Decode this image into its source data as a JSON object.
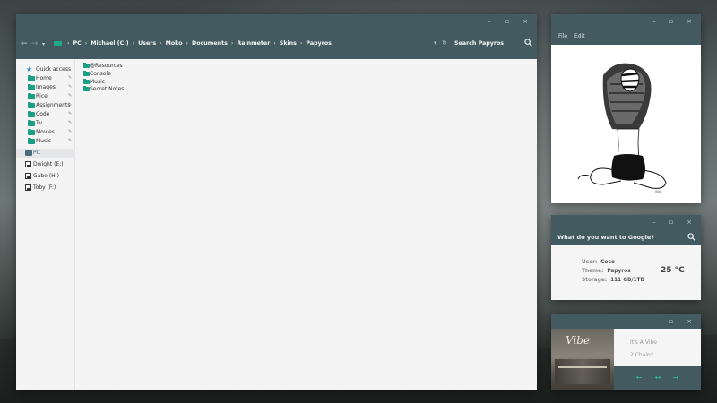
{
  "explorer": {
    "controls": {
      "minimize": "–",
      "maximize": "▫",
      "close": "×"
    },
    "nav": {
      "back": "←",
      "forward": "→",
      "up": "↑"
    },
    "breadcrumbs": [
      "PC",
      "Michael (C:)",
      "Users",
      "Moko",
      "Documents",
      "Rainmeter",
      "Skins",
      "Papyros"
    ],
    "search_placeholder": "Search Papyros",
    "sidebar": {
      "quick_access_label": "Quick access",
      "pinned": [
        {
          "label": "Home",
          "pin": "✎"
        },
        {
          "label": "Images",
          "pin": "✎"
        },
        {
          "label": "Rice",
          "pin": "✎"
        },
        {
          "label": "Assignments",
          "pin": "✎"
        },
        {
          "label": "Code",
          "pin": "✎"
        },
        {
          "label": "Tv",
          "pin": "✎"
        },
        {
          "label": "Movies",
          "pin": "✎"
        },
        {
          "label": "Music",
          "pin": "✎"
        }
      ],
      "pc_label": "PC",
      "drives": [
        "Dwight (E:)",
        "Gabe (H:)",
        "Toby (F:)"
      ]
    },
    "files": [
      "@Resources",
      "Console",
      "Music",
      "Secret Notes"
    ]
  },
  "viewer": {
    "controls": {
      "minimize": "–",
      "maximize": "▫",
      "close": "×"
    },
    "menu": [
      "File",
      "Edit"
    ]
  },
  "google": {
    "controls": {
      "minimize": "–",
      "maximize": "▫",
      "close": "×"
    },
    "prompt": "What do you want to Google?",
    "user_label": "User:",
    "user_value": "Coco",
    "theme_label": "Theme:",
    "theme_value": "Papyros",
    "storage_label": "Storage:",
    "storage_value": "111 GB/1TB",
    "temperature": "25 °C"
  },
  "music": {
    "controls": {
      "minimize": "–",
      "maximize": "▫",
      "close": "×"
    },
    "album_text": "Vibe",
    "track_title": "It's A Vibe",
    "artist": "2 Chainz",
    "buttons": {
      "prev": "←",
      "play": "↔",
      "next": "→"
    }
  },
  "colors": {
    "titlebar": "#425a60",
    "accent": "#199f83"
  }
}
